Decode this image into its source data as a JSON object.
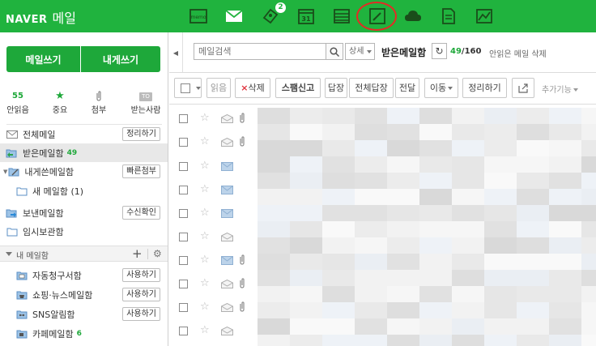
{
  "brand": {
    "logo": "NAVER",
    "service": "메일"
  },
  "top_apps": [
    {
      "icon": "memo-icon"
    },
    {
      "icon": "mail-icon"
    },
    {
      "icon": "address-book-icon",
      "badge": "2"
    },
    {
      "icon": "calendar-icon",
      "text": "31"
    },
    {
      "icon": "list-icon"
    },
    {
      "icon": "note-edit-icon",
      "highlighted": true
    },
    {
      "icon": "cloud-icon"
    },
    {
      "icon": "document-icon"
    },
    {
      "icon": "chart-icon"
    }
  ],
  "compose": {
    "write_mail": "메일쓰기",
    "write_to_self": "내게쓰기"
  },
  "quick": [
    {
      "top": "55",
      "label": "안읽음"
    },
    {
      "top": "★",
      "label": "중요"
    },
    {
      "top": "📎",
      "label": "첨부"
    },
    {
      "top": "TO",
      "label": "받는사람"
    }
  ],
  "folders": [
    {
      "name": "전체메일",
      "button": "정리하기"
    },
    {
      "name": "받은메일함",
      "count": "49",
      "selected": true
    },
    {
      "name": "내게쓴메일함",
      "button": "빠른첨부"
    },
    {
      "name": "새 메일함 (1)"
    },
    {
      "name": "보낸메일함",
      "button": "수신확인"
    },
    {
      "name": "임시보관함"
    }
  ],
  "my_mailbox": {
    "title": "내 메일함",
    "add": "+",
    "settings": "⚙"
  },
  "my_folders": [
    {
      "name": "자동청구서함",
      "button": "사용하기"
    },
    {
      "name": "쇼핑·뉴스메일함",
      "button": "사용하기"
    },
    {
      "name": "SNS알림함",
      "button": "사용하기"
    },
    {
      "name": "카페메일함",
      "count": "6"
    }
  ],
  "search": {
    "placeholder": "메일검색",
    "detail": "상세"
  },
  "current_box": {
    "title": "받은메일함",
    "unread": "49",
    "total": "/160",
    "delete_unread": "안읽은 메일 삭제"
  },
  "toolbar": {
    "read": "읽음",
    "delete": "삭제",
    "spam": "스팸신고",
    "reply": "답장",
    "reply_all": "전체답장",
    "forward": "전달",
    "move": "이동",
    "organize": "정리하기",
    "more": "추가기능"
  },
  "rows": [
    {
      "read": true,
      "attach": true
    },
    {
      "read": true,
      "attach": true
    },
    {
      "read": false,
      "attach": false
    },
    {
      "read": false,
      "attach": false
    },
    {
      "read": false,
      "attach": false
    },
    {
      "read": true,
      "attach": false
    },
    {
      "read": false,
      "attach": true
    },
    {
      "read": true,
      "attach": true
    },
    {
      "read": true,
      "attach": true
    },
    {
      "read": true,
      "attach": false
    }
  ],
  "colors": {
    "brand_green": "#20b33e",
    "count_green": "#1ea83a",
    "highlight_red": "#e42b25",
    "delete_red": "#e0323c"
  }
}
